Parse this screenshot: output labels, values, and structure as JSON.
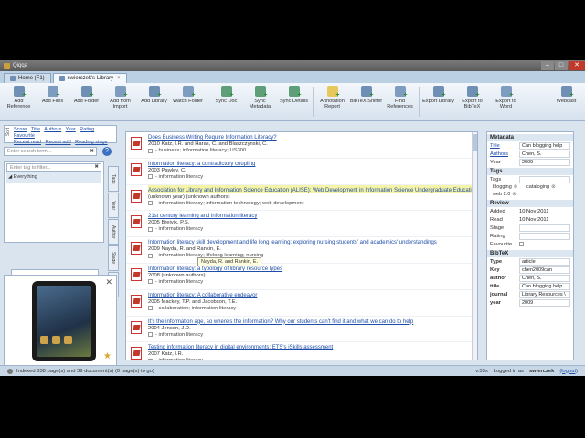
{
  "app": {
    "title": "Qiqqa"
  },
  "tabs": [
    {
      "label": "Home (F1)"
    },
    {
      "label": "swierczek's Library",
      "close": "×"
    }
  ],
  "ribbon": [
    {
      "label": "Add Reference"
    },
    {
      "label": "Add Files"
    },
    {
      "label": "Add Folder"
    },
    {
      "label": "Add from Import"
    },
    {
      "label": "Add Library"
    },
    {
      "label": "Watch Folder"
    },
    {
      "label": "Sync Doc"
    },
    {
      "label": "Sync Metadata"
    },
    {
      "label": "Sync Details"
    },
    {
      "label": "Annotation Report"
    },
    {
      "label": "BibTeX Sniffer"
    },
    {
      "label": "Find References"
    },
    {
      "label": "Export Library"
    },
    {
      "label": "Export to BibTeX"
    },
    {
      "label": "Export to Word"
    },
    {
      "label": "Webcast"
    }
  ],
  "sort": {
    "label": "Sort",
    "links": [
      "Score",
      "Title",
      "Authors",
      "Year",
      "Rating",
      "Favourite",
      "Recent read",
      "Recent add",
      "Reading stage"
    ]
  },
  "search": {
    "placeholder": "Enter search term...",
    "clear": "✖",
    "help": "?"
  },
  "tagfilter": {
    "placeholder": "Enter tag to filter...",
    "clear": "✖",
    "everything": "Everything"
  },
  "sidetabs": [
    "Tags",
    "Year",
    "Author",
    "Stage",
    "Rating",
    "Author"
  ],
  "histogram": {
    "values": [
      0.7,
      0.55,
      0.95,
      0.15,
      0.05,
      0.04,
      0.03
    ]
  },
  "preview": {
    "close": "✕",
    "star": "★"
  },
  "documents": [
    {
      "title": "Does Business Writing Require Information Literacy?",
      "meta": "2010  Katz, I.R. and Haras, C. and Blaszczynski, C.",
      "tags": "- business; information literacy; US300"
    },
    {
      "title": "Information literacy: a contradictory coupling",
      "meta": "2003  Pawley, C.",
      "tags": "- information literacy"
    },
    {
      "title": "Association for Library and Information Science Education (ALISE): Web Development in Information Science Undergraduate Educatio...",
      "meta": "(unknown year)  (unknown authors)",
      "tags": "- information literacy; information technology; web development"
    },
    {
      "title": "21st century learning and information literacy",
      "meta": "2005  Breivik, P.S.",
      "tags": "- information literacy"
    },
    {
      "title": "Information literacy skill development and life long learning: exploring nursing students' and academics' understandings",
      "meta": "2009  Nayda, R. and Rankin, E.",
      "tags": "- information literacy; lifelong learning; nursing"
    },
    {
      "title": "Information literacy: a typology of library resource types",
      "meta": "2008  (unknown authors)",
      "tags": "- information literacy"
    },
    {
      "title": "Information literacy: A collaborative endeavor",
      "meta": "2005  Mackey, T.P. and Jacobson, T.E.",
      "tags": "- collaboration; information literacy"
    },
    {
      "title": "It's the information age, so where's the information? Why our students can't find it and what we can do to help",
      "meta": "2004  Jenson, J.D.",
      "tags": "- information literacy"
    },
    {
      "title": "Testing information literacy in digital environments: ETS's iSkills assessment",
      "meta": "2007  Katz, I.R.",
      "tags": "- information literacy"
    }
  ],
  "tooltip": "Nayda, R. and Rankin, E.",
  "metadata": {
    "header": "Metadata",
    "title_label": "Title",
    "title_value": "Can blogging help",
    "authors_label": "Authors",
    "authors_value": "Chen, S.",
    "year_label": "Year",
    "year_value": "2009"
  },
  "tagsPanel": {
    "header": "Tags",
    "tags_label": "Tags",
    "chips": [
      "blogging",
      "cataloging",
      "web 2.0"
    ]
  },
  "review": {
    "header": "Review",
    "added_label": "Added",
    "added_value": "10 Nov 2011",
    "read_label": "Read",
    "read_value": "10 Nov 2011",
    "stage_label": "Stage",
    "rating_label": "Rating",
    "favourite_label": "Favourite"
  },
  "bibtex": {
    "header": "BibTeX",
    "type_label": "Type",
    "type_value": "article",
    "key_label": "Key",
    "key_value": "chen2009can",
    "author_label": "author",
    "author_value": "Chen, S.",
    "title_label": "title",
    "title_value": "Can blogging help",
    "journal_label": "journal",
    "journal_value": "Library Resources \\",
    "year_label": "year",
    "year_value": "2009"
  },
  "status": {
    "left": "Indexed 838 page(s) and 39 document(s) (0 page(s) to go)",
    "version": "v.33s",
    "logged": "Logged in as",
    "user": "swierczek",
    "logout": "(logout)"
  }
}
